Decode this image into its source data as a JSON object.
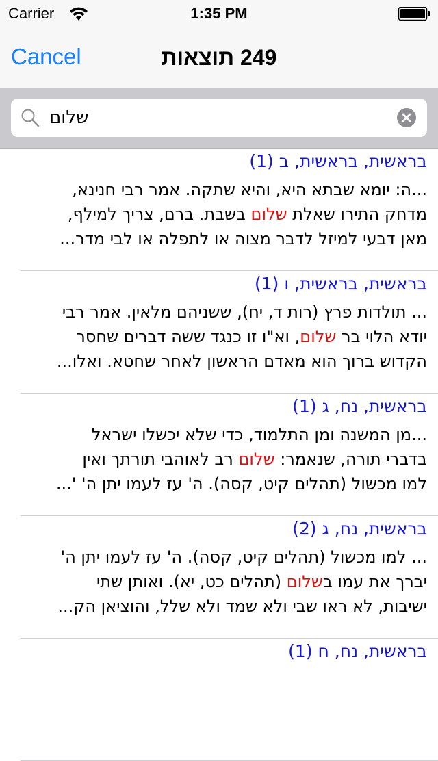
{
  "status_bar": {
    "carrier": "Carrier",
    "time": "1:35 PM"
  },
  "nav": {
    "cancel_label": "Cancel",
    "title": "249 תוצאות"
  },
  "search": {
    "value": "שלום",
    "highlight": "שלום"
  },
  "results": [
    {
      "title": "בראשית, בראשית, ב (1)",
      "lines": [
        "...ה: יומא שבתא היא, והיא שתקה. אמר רבי חנינא,",
        "מדחק התירו שאלת שלום בשבת. ברם, צריך למילף,",
        "מאן דבעי למיזל לדבר מצוה או לתפלה או לבי מדר..."
      ]
    },
    {
      "title": "בראשית, בראשית, ו (1)",
      "lines": [
        "... תולדות פרץ (רות ד, יח), ששניהם מלאין. אמר רבי",
        "יודא הלוי בר שלום, וא\"ו זו כנגד ששה דברים שחסר",
        "הקדוש ברוך הוא מאדם הראשון לאחר שחטא. ואלו..."
      ]
    },
    {
      "title": "בראשית, נח, ג (1)",
      "lines": [
        "...מן המשנה ומן התלמוד, כדי שלא יכשלו ישראל",
        "בדברי תורה, שנאמר: שלום רב לאוהבי תורתך ואין",
        "למו מכשול (תהלים קיט, קסה). ה' עז לעמו יתן ה' '..."
      ]
    },
    {
      "title": "בראשית, נח, ג (2)",
      "lines": [
        "... למו מכשול (תהלים קיט, קסה). ה' עז לעמו יתן ה'",
        "יברך את עמו בשלום (תהלים כט, יא). ואותן שתי",
        "ישיבות, לא ראו שבי ולא שמד ולא שלל, והוציאן הק..."
      ]
    },
    {
      "title": "בראשית, נח, ח (1)",
      "lines": []
    }
  ]
}
